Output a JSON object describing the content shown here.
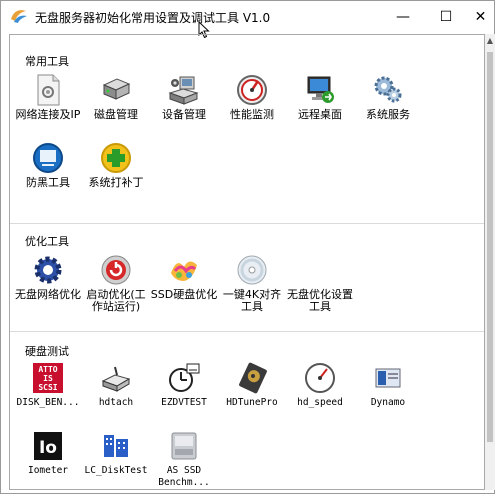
{
  "window": {
    "title": "无盘服务器初始化常用设置及调试工具 V1.0",
    "minimize_glyph": "—",
    "maximize_glyph": "☐",
    "close_glyph": "✕"
  },
  "groups": {
    "common": {
      "label": "常用工具",
      "items": [
        {
          "label": "网络连接及IP",
          "icon": "network-connections-icon"
        },
        {
          "label": "磁盘管理",
          "icon": "disk-management-icon"
        },
        {
          "label": "设备管理",
          "icon": "device-manager-icon"
        },
        {
          "label": "性能监测",
          "icon": "performance-monitor-icon"
        },
        {
          "label": "远程桌面",
          "icon": "remote-desktop-icon"
        },
        {
          "label": "系统服务",
          "icon": "system-services-icon"
        },
        {
          "label": "防黑工具",
          "icon": "anti-hack-tool-icon"
        },
        {
          "label": "系统打补丁",
          "icon": "system-patch-icon"
        }
      ]
    },
    "optimize": {
      "label": "优化工具",
      "items": [
        {
          "label": "无盘网络优化",
          "icon": "network-optimize-gear-icon"
        },
        {
          "label": "启动优化(工作站运行)",
          "icon": "startup-optimize-icon"
        },
        {
          "label": "SSD硬盘优化",
          "icon": "ssd-optimize-icon"
        },
        {
          "label": "一键4K对齐工具",
          "icon": "4k-align-disc-icon"
        },
        {
          "label": "无盘优化设置工具",
          "icon": ""
        }
      ]
    },
    "disk_test": {
      "label": "硬盘测试",
      "items": [
        {
          "label": "DISK_BEN...",
          "icon": "atto-disk-benchmark-icon"
        },
        {
          "label": "hdtach",
          "icon": "hdtach-icon"
        },
        {
          "label": "EZDVTEST",
          "icon": "ezdvtest-icon"
        },
        {
          "label": "HDTunePro",
          "icon": "hdtunepro-icon"
        },
        {
          "label": "hd_speed",
          "icon": "hd-speed-gauge-icon"
        },
        {
          "label": "Dynamo",
          "icon": "dynamo-icon"
        },
        {
          "label": "Iometer",
          "icon": "iometer-icon"
        },
        {
          "label": "LC_DiskTest",
          "icon": "lc-disktest-icon"
        },
        {
          "label": "AS SSD Benchm...",
          "icon": "as-ssd-benchmark-icon"
        }
      ]
    }
  },
  "icon_texts": {
    "atto": [
      "ATTO",
      "IS",
      "SCSI"
    ],
    "iometer": "Io"
  }
}
